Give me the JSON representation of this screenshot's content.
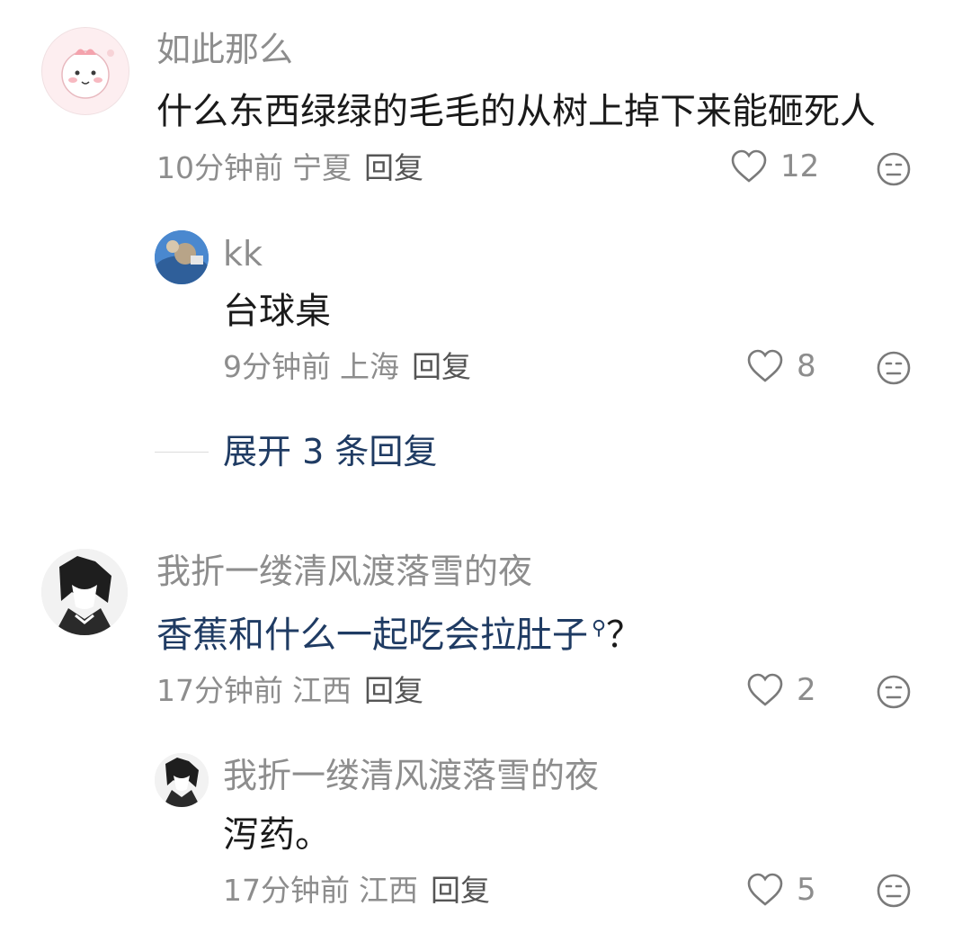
{
  "comments": [
    {
      "author": "如此那么",
      "text": "什么东西绿绿的毛毛的从树上掉下来能砸死人",
      "time": "10分钟前",
      "location": "宁夏",
      "reply_label": "回复",
      "likes": "12",
      "avatar_icon": "pink-cartoon-avatar",
      "replies": [
        {
          "author": "kk",
          "text": "台球桌",
          "time": "9分钟前",
          "location": "上海",
          "reply_label": "回复",
          "likes": "8",
          "avatar_icon": "blue-photo-avatar"
        }
      ],
      "expand_label": "展开 3 条回复"
    },
    {
      "author": "我折一缕清风渡落雪的夜",
      "text": "香蕉和什么一起吃会拉肚子",
      "text_suffix": "？",
      "time": "17分钟前",
      "location": "江西",
      "reply_label": "回复",
      "likes": "2",
      "avatar_icon": "monochrome-anime-avatar",
      "replies": [
        {
          "author": "我折一缕清风渡落雪的夜",
          "text": "泻药。",
          "time": "17分钟前",
          "location": "江西",
          "reply_label": "回复",
          "likes": "5",
          "avatar_icon": "monochrome-anime-avatar"
        }
      ]
    }
  ],
  "colors": {
    "link": "#1f3b63",
    "muted": "#8d8d8d",
    "text": "#1a1a1a"
  }
}
